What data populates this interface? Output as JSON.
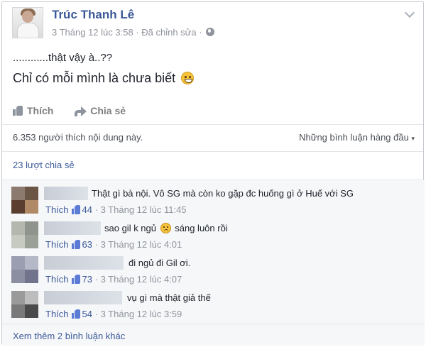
{
  "post": {
    "author": "Trúc Thanh Lê",
    "timestamp": "3 Tháng 12 lúc 3:58",
    "edited": "· Đã chỉnh sửa ·",
    "line1": "............thật vậy à..??",
    "line2": "Chỉ có mỗi mình là chưa biết",
    "privacy_icon": "globe-icon",
    "emoji": "smile-emoji-icon"
  },
  "actions": {
    "like_label": "Thích",
    "share_label": "Chia sẻ"
  },
  "summary": {
    "likes_text": "6.353 người thích nội dung này.",
    "comment_sort": "Những bình luận hàng đầu",
    "shares_text": "23 lượt chia sẻ"
  },
  "comments": [
    {
      "text": "Thật gì bà nội. Vô SG mà còn ko gặp đc huống gì ở Huế với SG",
      "like_label": "Thích",
      "likes": "44",
      "time": "3 Tháng 12 lúc 11:45",
      "avatar_colors": [
        "#8d7a6e",
        "#6b5545",
        "#5a3f31",
        "#b08a66"
      ]
    },
    {
      "text_before": "sao gil k ngủ",
      "text_after": "sáng luôn rồi",
      "like_label": "Thích",
      "likes": "63",
      "time": "3 Tháng 12 lúc 4:01",
      "avatar_colors": [
        "#b3b7ad",
        "#8f958c",
        "#c6cac1",
        "#9ba196"
      ]
    },
    {
      "text": "đi ngủ đi Gil ơi.",
      "like_label": "Thích",
      "likes": "73",
      "time": "3 Tháng 12 lúc 4:07",
      "avatar_colors": [
        "#9b9eb0",
        "#b5b8c7",
        "#8c8fa2",
        "#70748c"
      ]
    },
    {
      "text": "vụ gì mà thật giả thế",
      "like_label": "Thích",
      "likes": "54",
      "time": "3 Tháng 12 lúc 3:59",
      "avatar_colors": [
        "#9a9a9a",
        "#bdbdbd",
        "#7a7a7a",
        "#4a4a4a"
      ]
    }
  ],
  "footer": {
    "more_comments": "Xem thêm 2 bình luận khác"
  }
}
